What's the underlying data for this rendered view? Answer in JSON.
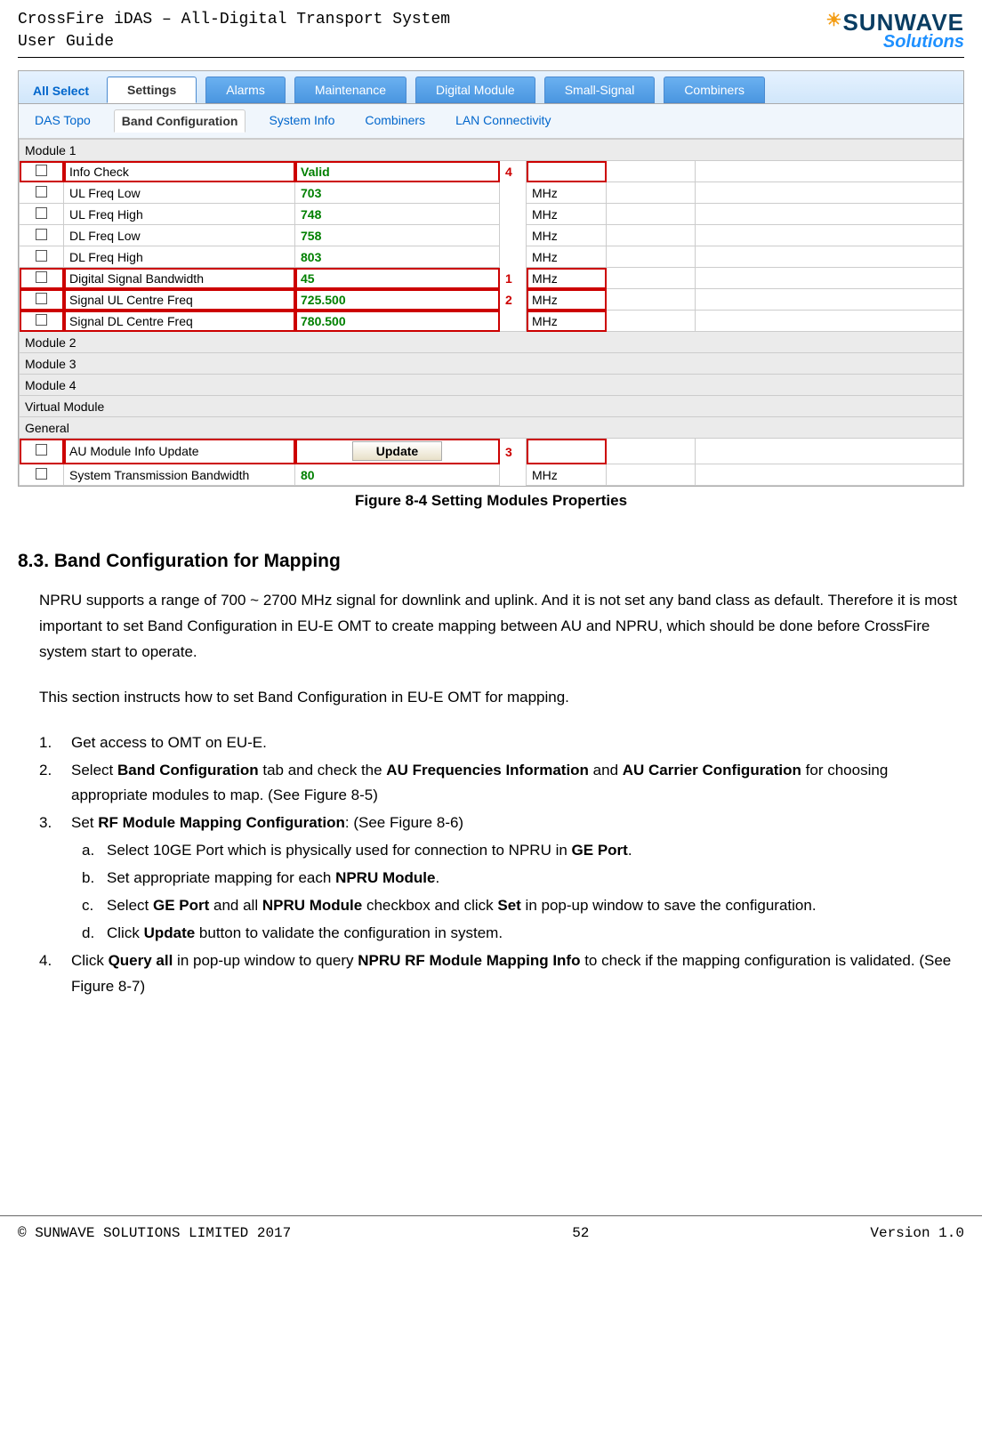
{
  "header": {
    "title_line1": "CrossFire iDAS – All-Digital Transport System",
    "title_line2": "User Guide",
    "logo_main": "SUNWAVE",
    "logo_sub": "Solutions"
  },
  "ui": {
    "all_select": "All Select",
    "main_tabs": [
      "Settings",
      "Alarms",
      "Maintenance",
      "Digital Module",
      "Small-Signal",
      "Combiners"
    ],
    "main_active": 0,
    "sub_tabs": [
      "DAS Topo",
      "Band Configuration",
      "System Info",
      "Combiners",
      "LAN Connectivity"
    ],
    "sub_active": 1,
    "sections": {
      "module1": "Module 1",
      "module2": "Module 2",
      "module3": "Module 3",
      "module4": "Module 4",
      "virtual": "Virtual Module",
      "general": "General"
    },
    "rows_module1": [
      {
        "name": "Info Check",
        "val": "Valid",
        "unit": "",
        "ann": "4",
        "hl": true
      },
      {
        "name": "UL Freq Low",
        "val": "703",
        "unit": "MHz",
        "ann": "",
        "hl": false
      },
      {
        "name": "UL Freq High",
        "val": "748",
        "unit": "MHz",
        "ann": "",
        "hl": false
      },
      {
        "name": "DL Freq Low",
        "val": "758",
        "unit": "MHz",
        "ann": "",
        "hl": false
      },
      {
        "name": "DL Freq High",
        "val": "803",
        "unit": "MHz",
        "ann": "",
        "hl": false
      },
      {
        "name": "Digital Signal Bandwidth",
        "val": "45",
        "unit": "MHz",
        "ann": "1",
        "hl": true
      },
      {
        "name": "Signal UL Centre Freq",
        "val": "725.500",
        "unit": "MHz",
        "ann": "2",
        "hl": true
      },
      {
        "name": "Signal DL Centre Freq",
        "val": "780.500",
        "unit": "MHz",
        "ann": "",
        "hl": true
      }
    ],
    "general_rows": {
      "update": {
        "name": "AU Module Info Update",
        "btn": "Update",
        "ann": "3"
      },
      "bandwidth": {
        "name": "System Transmission Bandwidth",
        "val": "80",
        "unit": "MHz"
      }
    }
  },
  "figure_caption": "Figure 8-4 Setting Modules Properties",
  "section": {
    "heading": "8.3. Band Configuration for Mapping",
    "p1": "NPRU supports a range of 700 ~ 2700 MHz signal for downlink and uplink. And it is not set any band class as default. Therefore it is most important to set Band Configuration in EU-E OMT to create mapping between AU and NPRU, which should be done before CrossFire system start to operate.",
    "p2": "This section instructs how to set Band Configuration in EU-E OMT for mapping.",
    "step1": "Get access to OMT on EU-E.",
    "step2_a": "Select ",
    "step2_b": "Band Configuration",
    "step2_c": " tab and check the ",
    "step2_d": "AU Frequencies Information",
    "step2_e": " and ",
    "step2_f": "AU Carrier Configuration",
    "step2_g": " for choosing appropriate modules to map. (See Figure 8-5)",
    "step3_a": "Set ",
    "step3_b": "RF Module Mapping Configuration",
    "step3_c": ": (See Figure 8-6)",
    "sub_a_1": "Select 10GE Port which is physically used for connection to NPRU in ",
    "sub_a_2": "GE Port",
    "sub_a_3": ".",
    "sub_b_1": "Set appropriate mapping for each ",
    "sub_b_2": "NPRU Module",
    "sub_b_3": ".",
    "sub_c_1": "Select ",
    "sub_c_2": "GE Port",
    "sub_c_3": " and all ",
    "sub_c_4": "NPRU Module",
    "sub_c_5": " checkbox and click ",
    "sub_c_6": "Set",
    "sub_c_7": " in pop-up window to save the configuration.",
    "sub_d_1": "Click ",
    "sub_d_2": "Update",
    "sub_d_3": " button to validate the configuration in system.",
    "step4_a": "Click ",
    "step4_b": "Query all",
    "step4_c": " in pop-up window to query ",
    "step4_d": "NPRU RF Module Mapping Info",
    "step4_e": " to check if the mapping configuration is validated. (See Figure 8-7)"
  },
  "footer": {
    "left": "© SUNWAVE SOLUTIONS LIMITED 2017",
    "center": "52",
    "right": "Version 1.0"
  }
}
